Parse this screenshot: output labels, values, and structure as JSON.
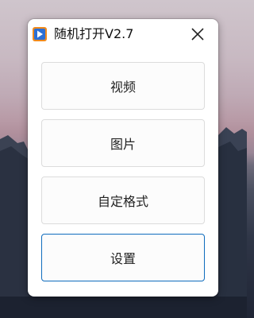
{
  "window": {
    "title": "随机打开V2.7",
    "app_icon": "play-icon",
    "close_icon": "close-icon"
  },
  "buttons": [
    {
      "label": "视频"
    },
    {
      "label": "图片"
    },
    {
      "label": "自定格式"
    },
    {
      "label": "设置"
    }
  ],
  "colors": {
    "accent": "#0f6cbd",
    "icon_orange": "#f08a1c",
    "icon_blue": "#2b6fd6"
  }
}
